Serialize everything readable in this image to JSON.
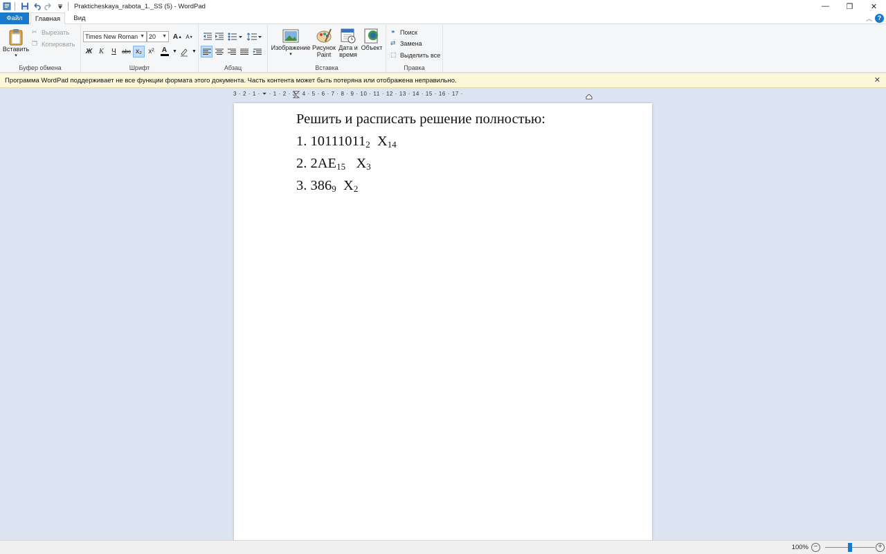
{
  "window": {
    "title": "Prakticheskaya_rabota_1._SS (5) - WordPad",
    "controls": {
      "minimize": "—",
      "restore": "❐",
      "close": "✕"
    }
  },
  "tabs": [
    {
      "label": "Файл"
    },
    {
      "label": "Главная"
    },
    {
      "label": "Вид"
    }
  ],
  "ribbon": {
    "clipboard": {
      "label": "Буфер обмена",
      "paste": "Вставить",
      "cut": "Вырезать",
      "copy": "Копировать"
    },
    "font": {
      "label": "Шрифт",
      "family": "Times New Roman",
      "size": "20",
      "bold": "Ж",
      "italic": "К",
      "underline": "Ч",
      "strike": "abc",
      "subscript": "x₂",
      "superscript": "x²",
      "grow": "A",
      "shrink": "A",
      "color": "A"
    },
    "paragraph": {
      "label": "Абзац"
    },
    "insert": {
      "label": "Вставка",
      "image": "Изображение",
      "paint1": "Рисунок",
      "paint2": "Paint",
      "datetime1": "Дата и",
      "datetime2": "время",
      "object": "Объект"
    },
    "editing": {
      "label": "Правка",
      "find": "Поиск",
      "replace": "Замена",
      "select_all": "Выделить все"
    }
  },
  "infobar": {
    "message": "Программа WordPad поддерживает не все функции формата этого документа. Часть контента может быть потеряна или отображена неправильно.",
    "close": "✕"
  },
  "ruler": {
    "scale": "3 · 2 · 1 · ⏷ · 1 · 2 · 3 · 4 · 5 · 6 · 7 · 8 · 9 · 10 · 11 · 12 · 13 · 14 · 15 · 16 · 17 ·"
  },
  "document": {
    "heading": "Решить и расписать решение полностью:",
    "items": [
      {
        "prefix": "1. 10111011",
        "sub1": "2",
        "mid": "  X",
        "sub2": "14"
      },
      {
        "prefix": "2. 2AE",
        "sub1": "15",
        "mid": "   X",
        "sub2": "3"
      },
      {
        "prefix": "3. 386",
        "sub1": "9",
        "mid": "  X",
        "sub2": "2"
      }
    ]
  },
  "status": {
    "zoom": "100%",
    "zoom_out": "−",
    "zoom_in": "+",
    "zoom_level": 0.5
  }
}
